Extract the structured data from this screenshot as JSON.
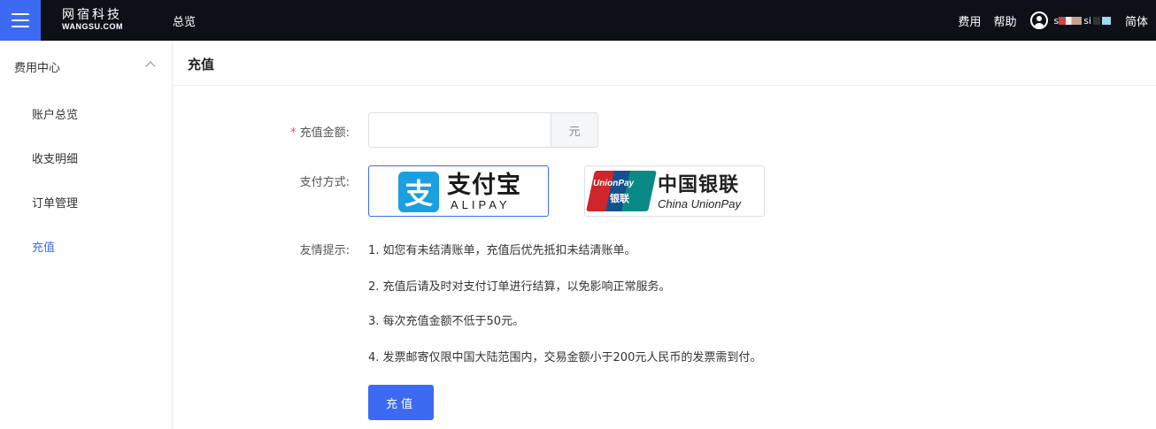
{
  "header": {
    "logo_cn": "网宿科技",
    "logo_en": "WANGSU.COM",
    "nav_overview": "总览",
    "fee": "费用",
    "help": "帮助",
    "user_name_start": "s",
    "user_name_mid": "si",
    "language": "简体"
  },
  "sidebar": {
    "group_label": "费用中心",
    "items": [
      {
        "label": "账户总览"
      },
      {
        "label": "收支明细"
      },
      {
        "label": "订单管理"
      },
      {
        "label": "充值"
      }
    ]
  },
  "page": {
    "title": "充值"
  },
  "form": {
    "amount_required_mark": "*",
    "amount_label": "充值金额:",
    "amount_value": "",
    "amount_unit": "元",
    "payment_label": "支付方式:",
    "payment_methods": [
      {
        "cn": "支付宝",
        "en": "ALIPAY",
        "mark": "支",
        "selected": true
      },
      {
        "cn": "中国银联",
        "en": "China UnionPay",
        "logo_en": "UnionPay",
        "logo_cn": "银联",
        "selected": false
      }
    ],
    "tips_label": "友情提示:",
    "tips": [
      "1. 如您有未结清账单，充值后优先抵扣未结清账单。",
      "2. 充值后请及时对支付订单进行结算，以免影响正常服务。",
      "3. 每次充值金额不低于50元。",
      "4. 发票邮寄仅限中国大陆范围内，交易金额小于200元人民币的发票需到付。"
    ],
    "submit_label": "充值"
  },
  "colors": {
    "accent": "#3d6af2",
    "topbar": "#0d1117",
    "required": "#f0502a",
    "alipay_blue": "#1a9fe0"
  }
}
